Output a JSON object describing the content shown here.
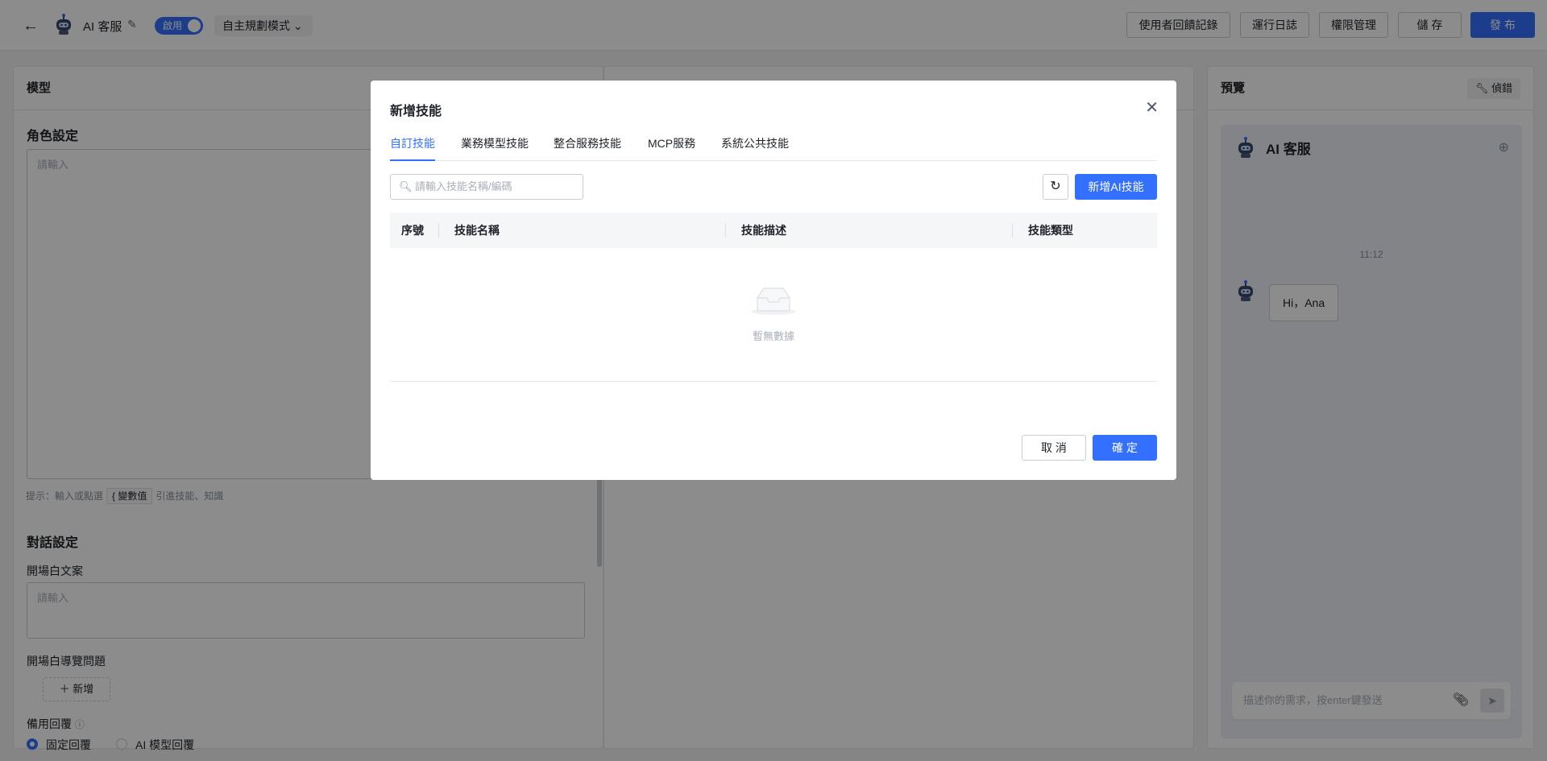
{
  "topbar": {
    "app_name": "AI 客服",
    "toggle_label": "啟用",
    "mode": "自主規劃模式",
    "buttons": {
      "feedback": "使用者回饋記錄",
      "logs": "運行日誌",
      "permissions": "權限管理",
      "save": "儲 存",
      "publish": "發 布"
    }
  },
  "left_panel": {
    "title": "模型",
    "role_label": "角色設定",
    "role_placeholder": "請輸入",
    "hint_prefix": "提示：輸入或點選",
    "hint_chip": "{ 變數值",
    "hint_suffix": "引進技能、知識",
    "dialog_label": "對話設定",
    "opening_label": "開場白文案",
    "opening_placeholder": "請輸入",
    "guide_label": "開場白導覽問題",
    "add_label": "新增",
    "fallback_label": "備用回覆",
    "radio_fixed": "固定回覆",
    "radio_ai": "AI 模型回覆"
  },
  "preview": {
    "title": "預覽",
    "edit_label": "偵錯",
    "chat_title": "AI 客服",
    "time": "11:12",
    "greeting": "Hi，Ana",
    "input_placeholder": "描述你的需求，按enter鍵發送"
  },
  "modal": {
    "title": "新增技能",
    "tabs": [
      "自訂技能",
      "業務模型技能",
      "整合服務技能",
      "MCP服務",
      "系統公共技能"
    ],
    "active_tab": 0,
    "search_placeholder": "請輸入技能名稱/編碼",
    "add_ai_label": "新增AI技能",
    "columns": [
      "序號",
      "技能名稱",
      "技能描述",
      "技能類型"
    ],
    "empty_text": "暫無數據",
    "cancel_label": "取 消",
    "ok_label": "確 定"
  },
  "colors": {
    "primary": "#3370ff",
    "overlay": "rgba(0,0,0,0.45)"
  }
}
